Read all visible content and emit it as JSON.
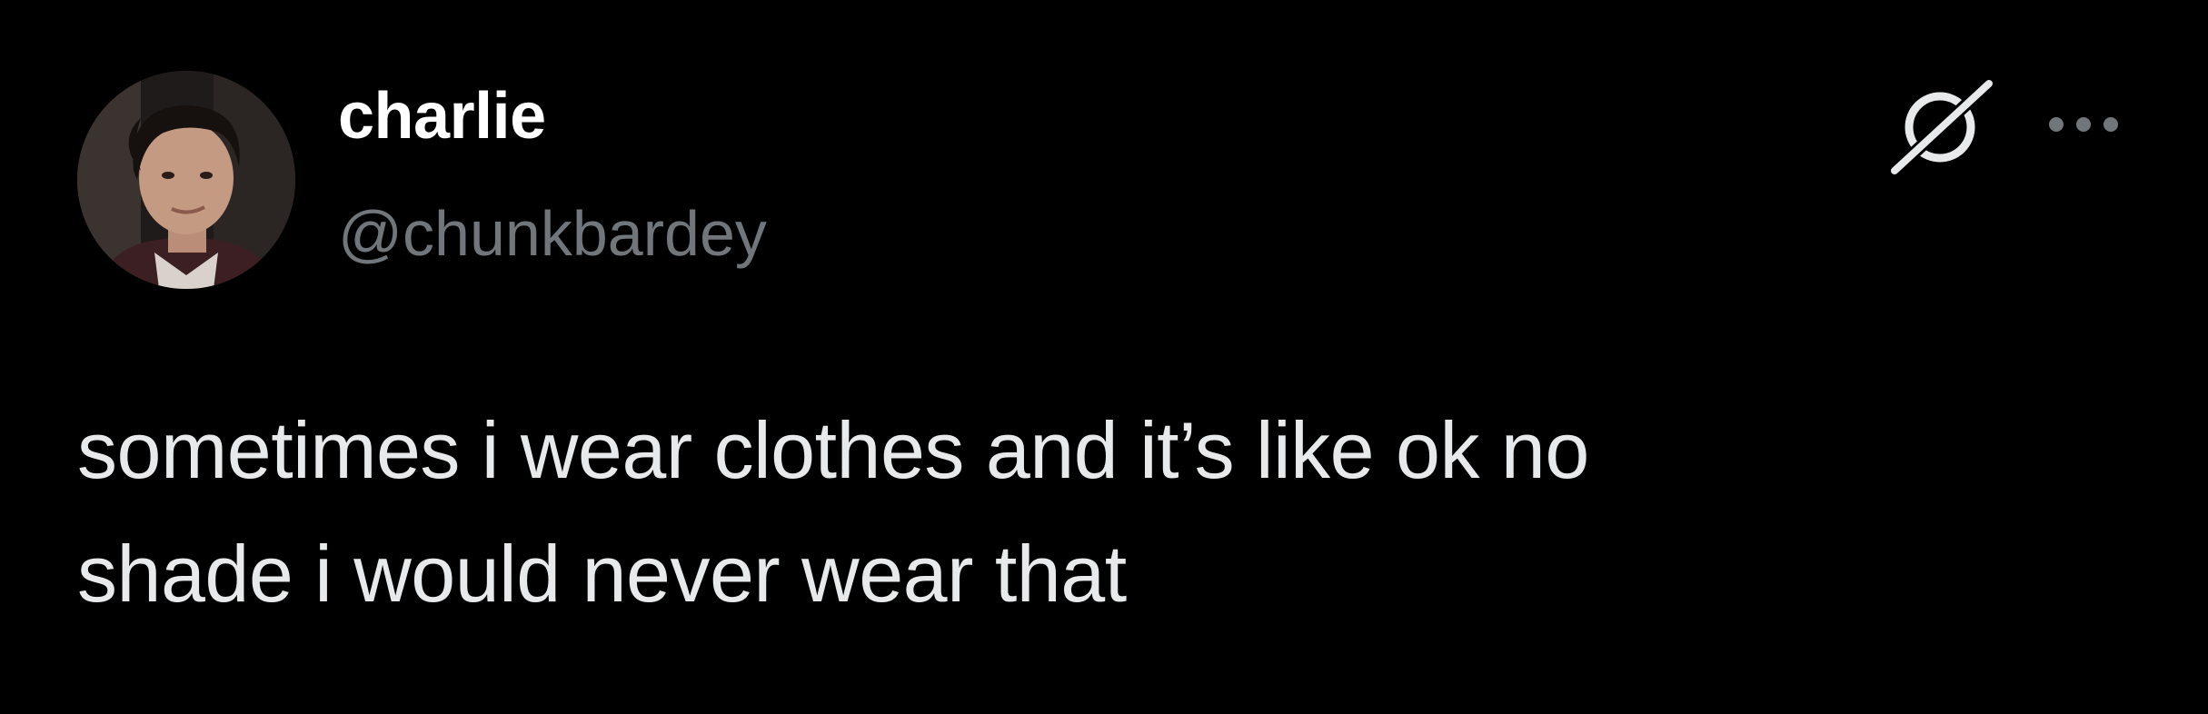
{
  "author": {
    "display_name": "charlie",
    "handle": "@chunkbardey"
  },
  "header_icons": {
    "grok": "grok-icon",
    "more": "more-icon"
  },
  "post": {
    "lines": [
      "sometimes i wear clothes and it’s like ok no",
      "shade i would never wear that"
    ]
  },
  "colors": {
    "background": "#000000",
    "name": "#ffffff",
    "handle": "#71767b",
    "text": "#e7e9ea"
  }
}
